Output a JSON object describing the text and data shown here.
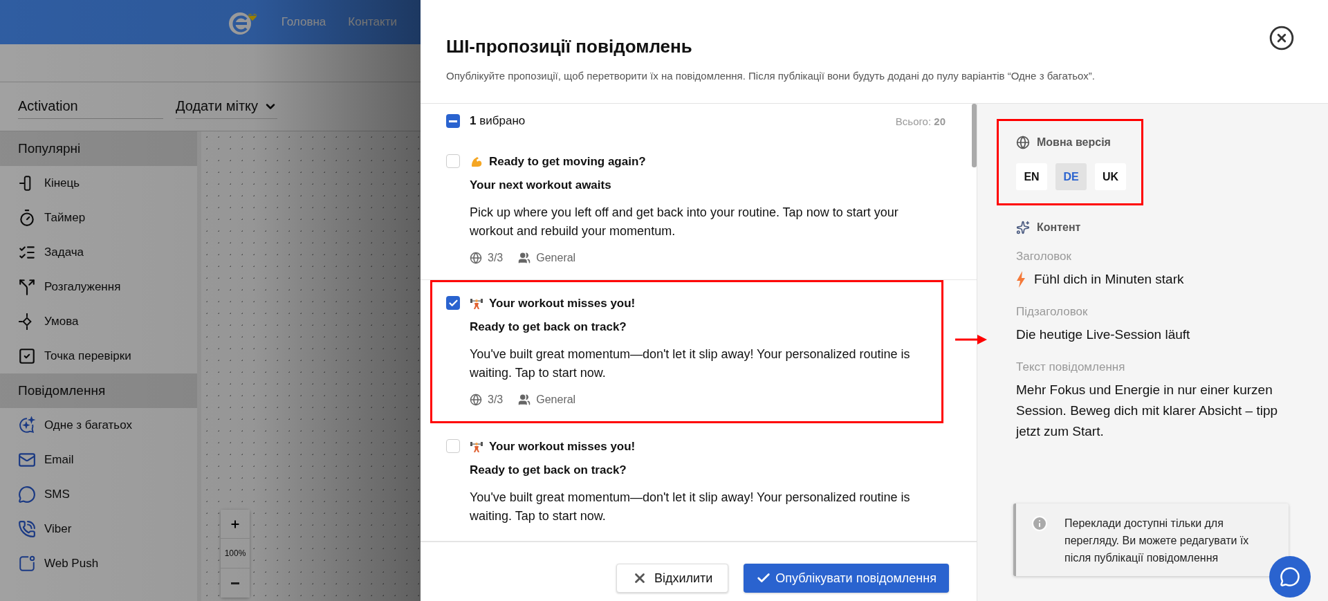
{
  "header": {
    "nav": [
      "Головна",
      "Контакти"
    ]
  },
  "toolbar": {
    "name_field": "Activation",
    "tag_dropdown": "Додати мітку"
  },
  "sidebar": {
    "sections": [
      {
        "title": "Популярні",
        "items": [
          "Кінець",
          "Таймер",
          "Задача",
          "Розгалуження",
          "Умова",
          "Точка перевірки"
        ]
      },
      {
        "title": "Повідомлення",
        "items": [
          "Одне з багатьох",
          "Email",
          "SMS",
          "Viber",
          "Web Push"
        ]
      }
    ]
  },
  "canvas": {
    "zoom": "100%"
  },
  "modal": {
    "title": "ШІ-пропозиції повідомлень",
    "subtitle": "Опублікуйте пропозиції, щоб перетворити їх на повідомлення. Після публікації вони будуть додані до пулу варіантів “Одне з багатьох”.",
    "selection": {
      "indeterminate": true,
      "count": "1",
      "label": "вибрано",
      "total_label": "Всього:",
      "total": "20"
    },
    "suggestions": [
      {
        "selected": false,
        "highlighted": false,
        "title": "Ready to get moving again?",
        "subtitle": "Your next workout awaits",
        "body": "Pick up where you left off and get back into your routine. Tap now to start your workout and rebuild your momentum.",
        "languages": "3/3",
        "segment": "General"
      },
      {
        "selected": true,
        "highlighted": true,
        "title": "Your workout misses you!",
        "subtitle": "Ready to get back on track?",
        "body": "You've built great momentum—don't let it slip away! Your personalized routine is waiting. Tap to start now.",
        "languages": "3/3",
        "segment": "General"
      },
      {
        "selected": false,
        "highlighted": false,
        "title": "Your workout misses you!",
        "subtitle": "Ready to get back on track?",
        "body": "You've built great momentum—don't let it slip away! Your personalized routine is waiting. Tap to start now."
      }
    ],
    "buttons": {
      "reject": "Відхилити",
      "publish": "Опублікувати повідомлення"
    },
    "preview": {
      "language_title": "Мовна версія",
      "highlighted": true,
      "languages": [
        {
          "label": "EN",
          "selected": false
        },
        {
          "label": "DE",
          "selected": true
        },
        {
          "label": "UK",
          "selected": false
        }
      ],
      "content_title": "Контент",
      "fields": [
        {
          "kind": "headline",
          "label": "Заголовок",
          "value": "Fühl dich in Minuten stark"
        },
        {
          "kind": "text",
          "label": "Підзаголовок",
          "value": "Die heutige Live-Session läuft"
        },
        {
          "kind": "text",
          "label": "Текст повідомлення",
          "value": "Mehr Fokus und Energie in nur einer kurzen Session. Beweg dich mit klarer Absicht – tipp jetzt zum Start."
        }
      ],
      "notice": "Переклади доступні тільки для перегляду. Ви можете редагувати їх після публікації повідомлення"
    }
  }
}
